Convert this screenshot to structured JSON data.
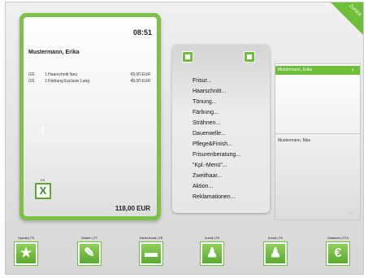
{
  "corner_tab": {
    "label": "Zurück"
  },
  "receipt": {
    "time": "08:51",
    "customer": "Mustermann, Erika",
    "items": [
      {
        "code": "GS",
        "description": "1 Haarschnitt Neu",
        "price": "69,00 EUR"
      },
      {
        "code": "GS",
        "description": "1 Färbung Exclusiv Lang",
        "price": "49,00 EUR"
      }
    ],
    "excel_key": "F8",
    "excel_icon": "X",
    "total": "118,00 EUR"
  },
  "service_menu": {
    "items": [
      "Frisur...",
      "Haarschnitt...",
      "Tönung...",
      "Färbung...",
      "Strähnen...",
      "Dauerwelle...",
      "Pflege&Finish...",
      "Frisurenberatung...",
      "\"Kpl.-Menü\"...",
      "Zweithaar...",
      "Aktion...",
      "Reklamationen..."
    ]
  },
  "customers": {
    "selected": "Mustermann, Erika",
    "other": "Mustermann, Max",
    "female_icon": "♀",
    "male_icon": "♂"
  },
  "function_keys": [
    {
      "label": "Spezial | F5",
      "icon": "★"
    },
    {
      "label": "Notizen | F7",
      "icon": "✎"
    },
    {
      "label": "Kartei-kunde | F8",
      "icon": "▬"
    },
    {
      "label": "Kunde | F9",
      "icon": "♟"
    },
    {
      "label": "Kunde | F9",
      "icon": "♟"
    },
    {
      "label": "Kassieren | F10",
      "icon": "€"
    }
  ],
  "colors": {
    "accent": "#6fbe3a",
    "accent_dark": "#5aa830"
  }
}
